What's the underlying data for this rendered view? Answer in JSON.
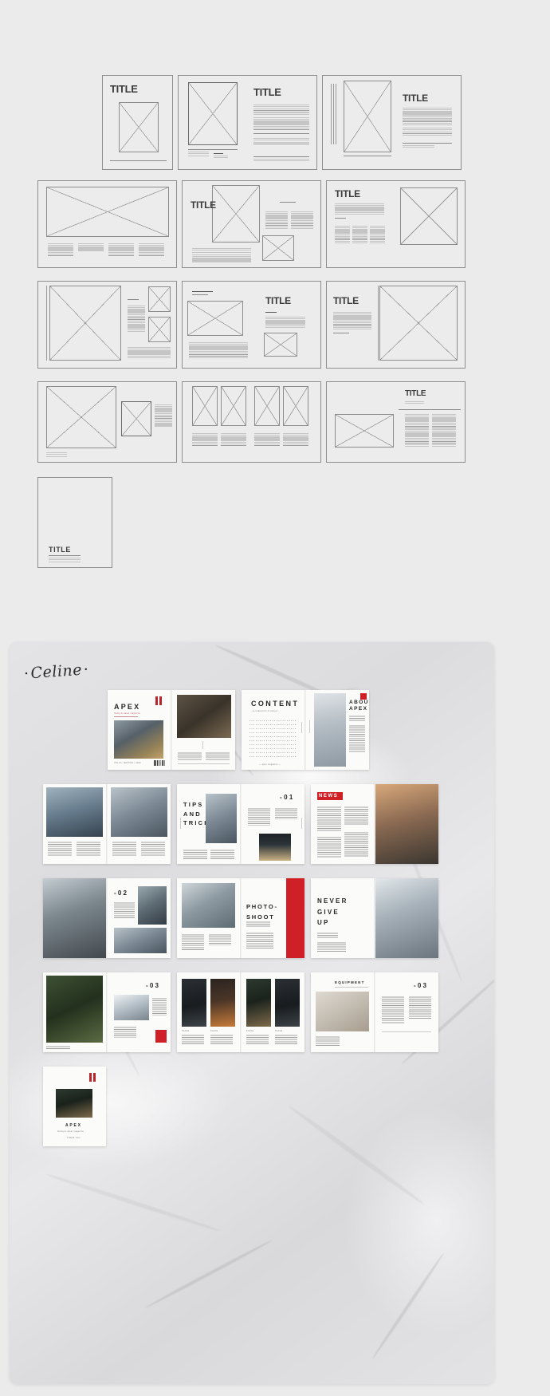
{
  "wireframes": {
    "section_label": "layout-wireframe-grid",
    "title_text": "TITLE",
    "rows": [
      {
        "cards": [
          {
            "id": "wf-1",
            "label": "TITLE",
            "kind": "portrait-title-top-image"
          },
          {
            "id": "wf-2",
            "label": "TITLE",
            "kind": "spread-image-left-text-right"
          },
          {
            "id": "wf-3",
            "label": "TITLE",
            "kind": "spread-rule-image-text"
          }
        ]
      },
      {
        "cards": [
          {
            "id": "wf-4",
            "label": "",
            "kind": "full-bleed-image-columns"
          },
          {
            "id": "wf-5",
            "label": "TITLE",
            "kind": "image-title-overlap-columns"
          },
          {
            "id": "wf-6",
            "label": "TITLE",
            "kind": "text-left-image-right"
          }
        ]
      },
      {
        "cards": [
          {
            "id": "wf-7",
            "label": "",
            "kind": "large-image-side-thumbs"
          },
          {
            "id": "wf-8",
            "label": "TITLE",
            "kind": "image-left-title-right"
          },
          {
            "id": "wf-9",
            "label": "TITLE",
            "kind": "title-text-left-image-right"
          }
        ]
      },
      {
        "cards": [
          {
            "id": "wf-10",
            "label": "",
            "kind": "image-plus-thumb-text"
          },
          {
            "id": "wf-11",
            "label": "",
            "kind": "four-thumbnail-grid"
          },
          {
            "id": "wf-12",
            "label": "TITLE",
            "kind": "title-top-image-text-columns"
          }
        ]
      },
      {
        "cards": [
          {
            "id": "wf-13",
            "label": "TITLE",
            "kind": "blank-page-title-bottom"
          }
        ]
      }
    ]
  },
  "mockup": {
    "brand": "Celine",
    "panel_name": "marble-presentation-board",
    "spread_rows": [
      {
        "row_index": 1,
        "spreads": [
          {
            "name": "cover-spread",
            "pages": [
              {
                "name": "cover-page",
                "headline": "APEX",
                "subtitle": "hiking & travel magazine",
                "caption": "VOL 01  /  EDITION  /  2020",
                "image": "coast",
                "accents": [
                  "red-double-mark",
                  "barcode"
                ]
              },
              {
                "name": "intro-photo-page",
                "headline": "",
                "body": "Mountains are the beginning and the end of all natural scenery.",
                "image": "hiker"
              }
            ]
          },
          {
            "name": "content-spread",
            "pages": [
              {
                "name": "table-of-contents-page",
                "headline": "CONTENT",
                "subtitle": "a curated list of stories",
                "toc": [
                  {
                    "label": "THE WILD PLACES",
                    "page": "02"
                  },
                  {
                    "label": "ABOUT APEX",
                    "page": "04"
                  },
                  {
                    "label": "GEAR",
                    "page": "06"
                  },
                  {
                    "label": "MOUNTAIN AIR",
                    "page": "08"
                  },
                  {
                    "label": "TIPS & TRICK",
                    "page": "11"
                  },
                  {
                    "label": "SUMMITS",
                    "page": "14"
                  },
                  {
                    "label": "PHOTO SHOOT",
                    "page": "17"
                  },
                  {
                    "label": "EXPEDITION",
                    "page": "20"
                  },
                  {
                    "label": "NEVER GIVE UP",
                    "page": "24"
                  },
                  {
                    "label": "EQUIPMENT",
                    "page": "28"
                  }
                ]
              },
              {
                "name": "about-page",
                "headline": "ABOUT\nAPEX",
                "image": "snow"
              }
            ]
          }
        ]
      },
      {
        "row_index": 2,
        "spreads": [
          {
            "name": "lake-spread",
            "pages": [
              {
                "name": "lake-photo-page",
                "image": "lake"
              },
              {
                "name": "lake-text-page",
                "image": "mount"
              }
            ]
          },
          {
            "name": "tips-spread",
            "pages": [
              {
                "name": "tips-cover-page",
                "headline": "TIPS\nAND\nTRICK",
                "image": "mount"
              },
              {
                "name": "tips-article-page",
                "headline": "-01",
                "image": "tent"
              }
            ]
          },
          {
            "name": "news-spread",
            "pages": [
              {
                "name": "news-page",
                "headline": "NEWS",
                "accent": "red-box"
              },
              {
                "name": "news-photo-page",
                "image": "sunset"
              }
            ]
          }
        ]
      },
      {
        "row_index": 3,
        "spreads": [
          {
            "name": "train-spread",
            "pages": [
              {
                "name": "train-photo-page",
                "image": "train"
              },
              {
                "name": "train-text-page",
                "headline": "-02",
                "image": "valley"
              }
            ]
          },
          {
            "name": "photoshoot-spread",
            "pages": [
              {
                "name": "river-photo-page",
                "image": "river"
              },
              {
                "name": "photoshoot-title-page",
                "headline": "PHOTO-\nSHOOT",
                "accent": "red-bar"
              }
            ]
          },
          {
            "name": "never-give-up-spread",
            "pages": [
              {
                "name": "never-give-up-page",
                "headline": "NEVER\nGIVE\nUP"
              },
              {
                "name": "climber-photo-page",
                "image": "cliff"
              }
            ]
          }
        ]
      },
      {
        "row_index": 4,
        "spreads": [
          {
            "name": "woods-spread",
            "pages": [
              {
                "name": "woods-photo-page",
                "image": "woods"
              },
              {
                "name": "woods-text-page",
                "headline": "-03",
                "image": "peak",
                "accent": "red-square"
              }
            ]
          },
          {
            "name": "gallery-spread",
            "pages": [
              {
                "name": "gallery-left-page",
                "images": [
                  "dark",
                  "fire"
                ]
              },
              {
                "name": "gallery-right-page",
                "images": [
                  "camp",
                  "dark"
                ]
              }
            ]
          },
          {
            "name": "equipment-spread",
            "pages": [
              {
                "name": "equipment-photo-page",
                "headline": "EQUIPMENT",
                "image": "gear"
              },
              {
                "name": "equipment-text-page",
                "headline": "-03"
              }
            ]
          }
        ]
      },
      {
        "row_index": 5,
        "spreads": [
          {
            "name": "back-cover-spread",
            "pages": [
              {
                "name": "back-cover-page",
                "headline": "APEX",
                "subtitle": "hiking & travel magazine",
                "caption": "THANK YOU",
                "image": "camp",
                "accents": [
                  "red-double-mark"
                ]
              }
            ]
          }
        ]
      }
    ]
  },
  "colors": {
    "background": "#ebebeb",
    "accent_red": "#cf2027",
    "mark_red": "#b8262b",
    "page_white": "#fbfbfa",
    "wire_stroke": "#8d8d8d",
    "text_dark": "#2b2b2b"
  }
}
